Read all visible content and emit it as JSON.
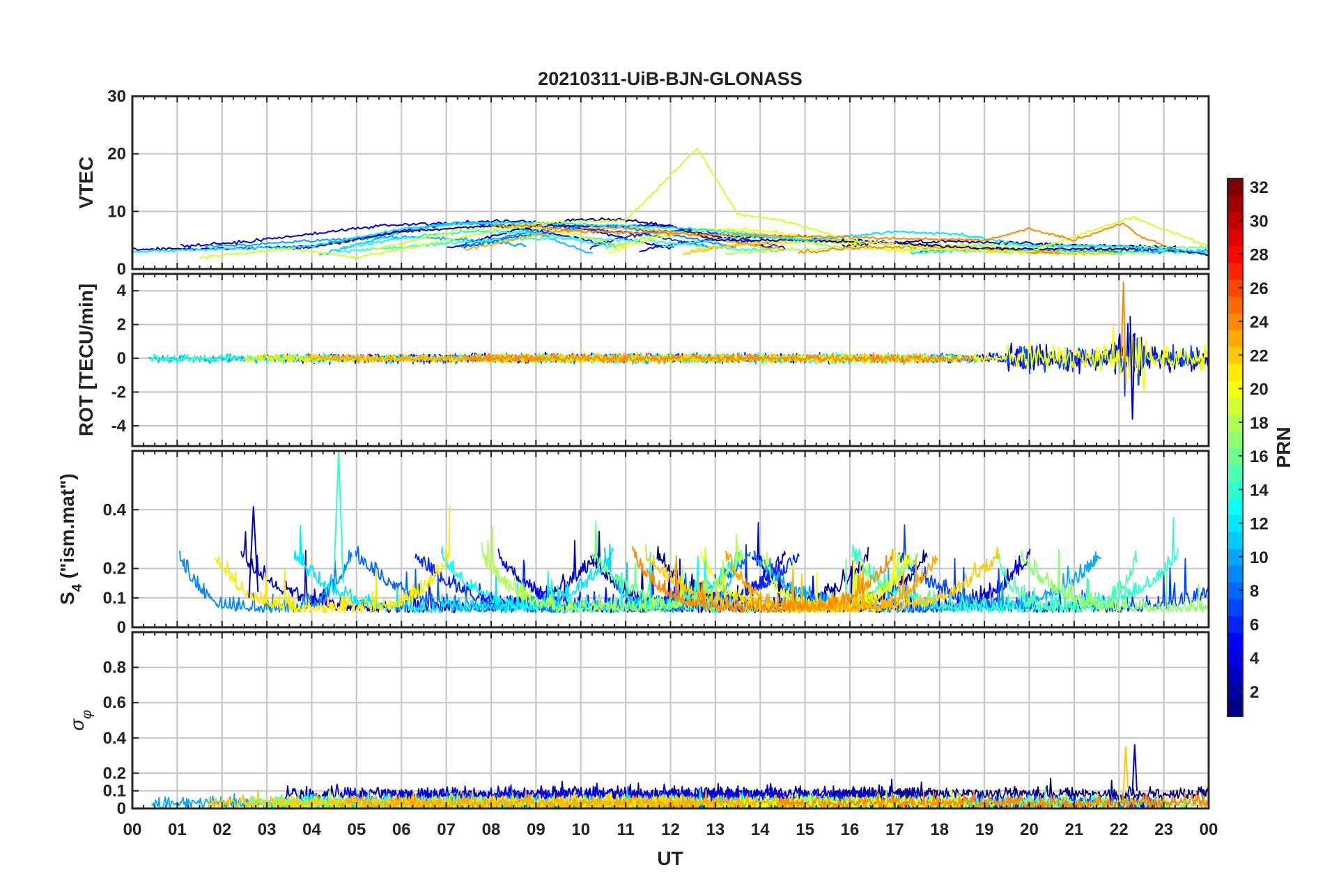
{
  "chart_data": {
    "type": "line",
    "title": "20210311-UiB-BJN-GLONASS",
    "xlabel": "UT",
    "x_tick_labels": [
      "00",
      "01",
      "02",
      "03",
      "04",
      "05",
      "06",
      "07",
      "08",
      "09",
      "10",
      "11",
      "12",
      "13",
      "14",
      "15",
      "16",
      "17",
      "18",
      "19",
      "20",
      "21",
      "22",
      "23",
      "00"
    ],
    "x_unit": "hours UT",
    "xlim": [
      0,
      24
    ],
    "colorbar": {
      "label": "PRN",
      "colormap": "jet",
      "range": [
        1,
        32
      ],
      "tick_values": [
        2,
        4,
        6,
        8,
        10,
        12,
        14,
        16,
        18,
        20,
        22,
        24,
        26,
        28,
        30,
        32
      ],
      "tick_labels": [
        "2",
        "4",
        "6",
        "8",
        "10",
        "12",
        "14",
        "16",
        "18",
        "20",
        "22",
        "24",
        "26",
        "28",
        "30",
        "32"
      ]
    },
    "panels": [
      {
        "id": "vtec",
        "ylabel": "VTEC",
        "ylim": [
          0,
          30
        ],
        "y_ticks": [
          0,
          10,
          20,
          30
        ],
        "y_tick_labels": [
          "0",
          "10",
          "20",
          "30"
        ],
        "grid": true,
        "series_note_samples": [
          {
            "prn": 2,
            "x": [
              0,
              2,
              4,
              6,
              8,
              10,
              12,
              13,
              15,
              17,
              19,
              21,
              23,
              24
            ],
            "y": [
              3.5,
              3.5,
              4,
              6.5,
              7.5,
              7.5,
              7.5,
              5,
              5,
              4.5,
              3.5,
              3.5,
              3.5,
              2.5
            ]
          },
          {
            "prn": 12,
            "x": [
              0,
              2,
              4,
              6,
              7.5,
              9,
              11,
              12.5,
              15,
              17,
              18.5,
              20,
              22,
              24
            ],
            "y": [
              3,
              3.5,
              4,
              7,
              8,
              8,
              7.5,
              7,
              5,
              6.5,
              6,
              4,
              4,
              3
            ]
          },
          {
            "prn": 19,
            "x": [
              1.5,
              3.5,
              5,
              7,
              9,
              11,
              12.6,
              13.5,
              14.5,
              16,
              18,
              20,
              22.3,
              24
            ],
            "y": [
              2,
              3.5,
              2,
              5,
              8,
              8.5,
              21,
              9.5,
              8.5,
              5,
              3.5,
              3,
              9,
              4
            ]
          },
          {
            "prn": 24,
            "x": [
              8,
              9,
              10,
              19,
              20,
              21,
              22.1,
              22.4,
              23
            ],
            "y": [
              7.5,
              7.5,
              6.5,
              5,
              7,
              5,
              8,
              6,
              4
            ]
          }
        ]
      },
      {
        "id": "rot",
        "ylabel": "ROT [TECU/min]",
        "ylim": [
          -5.2,
          5
        ],
        "y_ticks": [
          -4,
          -2,
          0,
          2,
          4
        ],
        "y_tick_labels": [
          "-4",
          "-2",
          "0",
          "2",
          "4"
        ],
        "grid": true,
        "series_note_samples": [
          {
            "prn": 24,
            "x": [
              22.05,
              22.1,
              22.15
            ],
            "y": [
              0,
              4.5,
              -1.5
            ]
          },
          {
            "prn": 3,
            "x": [
              22.25,
              22.3,
              22.35
            ],
            "y": [
              2.5,
              -3.6,
              1.5
            ]
          }
        ]
      },
      {
        "id": "s4",
        "ylabel": "S4 (\"ism.mat\")",
        "ylabel_base": "S",
        "ylabel_sub": "4",
        "ylabel_rest": " (\"ism.mat\")",
        "ylim": [
          0,
          0.6
        ],
        "y_ticks": [
          0,
          0.1,
          0.2,
          0.4
        ],
        "y_tick_labels": [
          "0",
          "0.1",
          "0.2",
          "0.4"
        ],
        "grid": true,
        "series_note_samples": [
          {
            "prn": 14,
            "x": [
              4.5,
              4.6,
              4.7
            ],
            "y": [
              0.2,
              0.6,
              0.15
            ]
          },
          {
            "prn": 3,
            "x": [
              2.6,
              2.7,
              2.8
            ],
            "y": [
              0.1,
              0.41,
              0.12
            ]
          }
        ]
      },
      {
        "id": "sigma_phi",
        "ylabel": "σφ",
        "ylabel_base": "σ",
        "ylabel_sub": "φ",
        "ylim": [
          0,
          1
        ],
        "y_ticks": [
          0,
          0.1,
          0.2,
          0.4,
          0.6,
          0.8
        ],
        "y_tick_labels": [
          "0",
          "0.1",
          "0.2",
          "0.4",
          "0.6",
          "0.8"
        ],
        "grid": true,
        "series_note_samples": [
          {
            "prn": 3,
            "x": [
              22.3,
              22.35,
              22.4
            ],
            "y": [
              0.1,
              0.36,
              0.1
            ]
          },
          {
            "prn": 22,
            "x": [
              22.1,
              22.15,
              22.2
            ],
            "y": [
              0.1,
              0.35,
              0.12
            ]
          }
        ]
      }
    ]
  }
}
